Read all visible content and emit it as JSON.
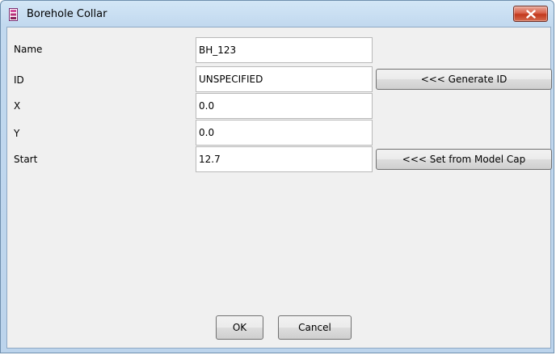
{
  "window": {
    "title": "Borehole Collar",
    "icon": "borehole-icon",
    "close_icon": "close-icon"
  },
  "form": {
    "rows": [
      {
        "label": "Name",
        "value": "BH_123"
      },
      {
        "label": "ID",
        "value": "UNSPECIFIED"
      },
      {
        "label": "X",
        "value": "0.0"
      },
      {
        "label": "Y",
        "value": "0.0"
      },
      {
        "label": "Start",
        "value": "12.7"
      }
    ],
    "generate_id_label": "<<< Generate ID",
    "set_from_model_cap_label": "<<< Set from Model Cap"
  },
  "buttons": {
    "ok_label": "OK",
    "cancel_label": "Cancel"
  },
  "colors": {
    "titlebar": "#c2d9ef",
    "close_button": "#c2381d",
    "client_background": "#f0f0f0"
  }
}
